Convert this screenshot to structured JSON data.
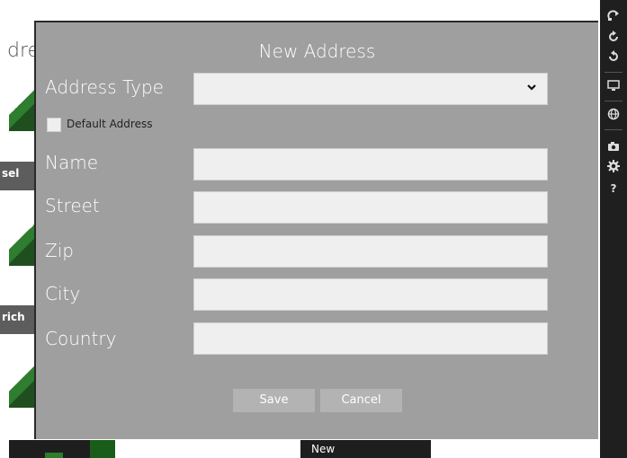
{
  "background": {
    "page_title_fragment": "dre",
    "tile_label_1": "sel",
    "tile_label_2": "rich",
    "bottom_tile_label": "New"
  },
  "charm_bar": {
    "icons": [
      "share-icon",
      "refresh-icon",
      "undo-icon",
      "display-icon",
      "globe-icon",
      "camera-icon",
      "settings-icon",
      "help-icon"
    ],
    "help_glyph": "?"
  },
  "dialog": {
    "title": "New Address",
    "address_type_label": "Address Type",
    "address_type_value": "",
    "default_address_label": "Default Address",
    "default_address_checked": false,
    "name_label": "Name",
    "name_value": "",
    "street_label": "Street",
    "street_value": "",
    "zip_label": "Zip",
    "zip_value": "",
    "city_label": "City",
    "city_value": "",
    "country_label": "Country",
    "country_value": "",
    "save_label": "Save",
    "cancel_label": "Cancel"
  },
  "colors": {
    "dialog_bg": "#9f9f9f",
    "input_bg": "#efefef",
    "button_bg": "#b3b3b3",
    "charm_bg": "#1f1f1f",
    "accent_green": "#2f7d2f"
  }
}
